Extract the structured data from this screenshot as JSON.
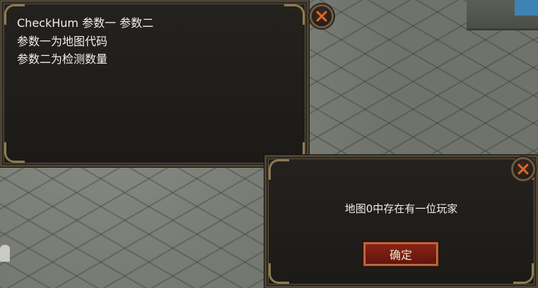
{
  "help_dialog": {
    "lines": [
      "CheckHum 参数一 参数二",
      "参数一为地图代码",
      "参数二为检测数量"
    ]
  },
  "result_dialog": {
    "message": "地图0中存在有一位玩家",
    "confirm_label": "确定"
  },
  "icons": {
    "close": "close-icon"
  },
  "colors": {
    "panel_bg": "#1f1d1a",
    "panel_border": "#5e523d",
    "close_x": "#e0662a",
    "confirm_bg": "#7a1f12"
  }
}
